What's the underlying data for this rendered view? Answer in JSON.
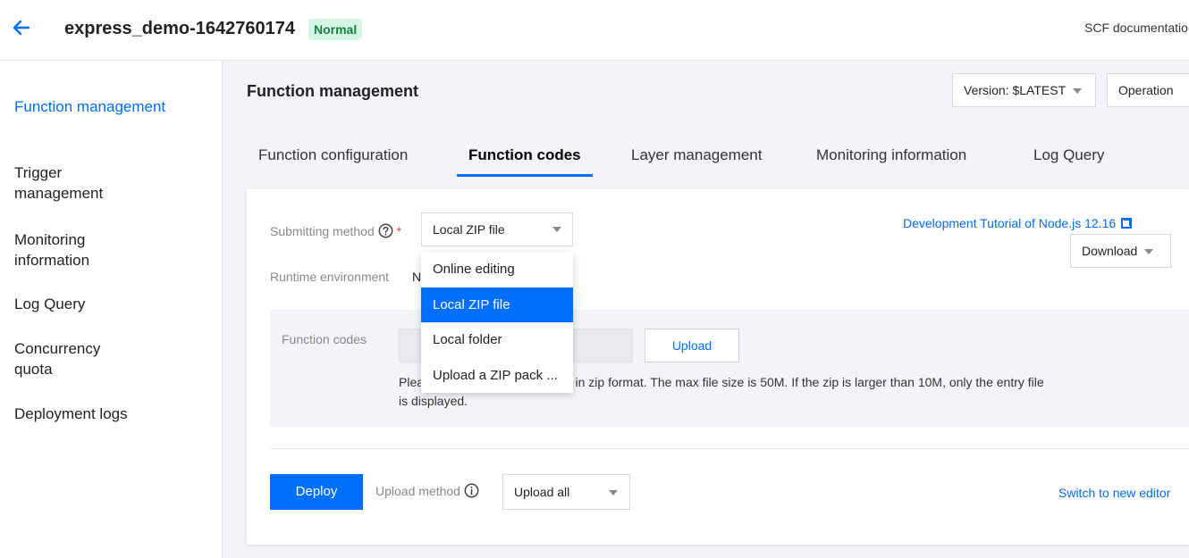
{
  "header": {
    "function_name": "express_demo-1642760174",
    "status": "Normal",
    "doc_link": "SCF documentation"
  },
  "sidebar": {
    "items": [
      {
        "label": "Function management",
        "active": true
      },
      {
        "label": "Trigger management"
      },
      {
        "label": "Monitoring information"
      },
      {
        "label": "Log Query"
      },
      {
        "label": "Concurrency quota"
      },
      {
        "label": "Deployment logs"
      }
    ]
  },
  "main": {
    "title": "Function management",
    "version_label": "Version: $LATEST",
    "operation_label": "Operation",
    "tabs": [
      {
        "label": "Function configuration"
      },
      {
        "label": "Function codes",
        "active": true
      },
      {
        "label": "Layer management"
      },
      {
        "label": "Monitoring information"
      },
      {
        "label": "Log Query"
      }
    ]
  },
  "form": {
    "submitting_method_label": "Submitting method",
    "submitting_method_value": "Local ZIP file",
    "runtime_label": "Runtime environment",
    "runtime_value": "N",
    "dev_tutorial_link": "Development Tutorial of Node.js 12.16",
    "download_label": "Download",
    "function_codes_label": "Function codes",
    "upload_button": "Upload",
    "hint_prefix": "Plea",
    "hint_text": "ge in zip format. The max file size is 50M. If the zip is larger than 10M, only the entry file",
    "hint_line2": "is displayed.",
    "deploy_button": "Deploy",
    "upload_method_label": "Upload method",
    "upload_method_value": "Upload all",
    "switch_editor_link": "Switch to new editor"
  },
  "dropdown": {
    "options": [
      {
        "label": "Online editing"
      },
      {
        "label": "Local ZIP file",
        "selected": true
      },
      {
        "label": "Local folder"
      },
      {
        "label": "Upload a ZIP pack ..."
      }
    ]
  }
}
